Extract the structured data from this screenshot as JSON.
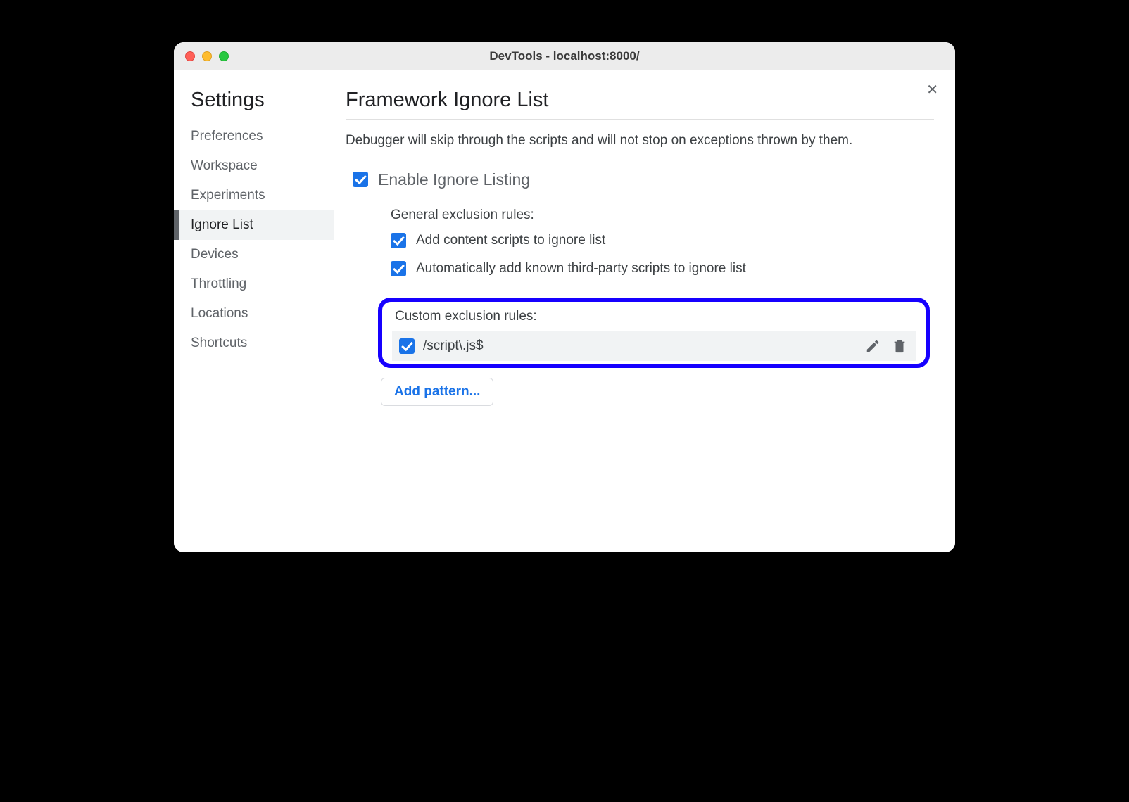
{
  "titlebar": {
    "title": "DevTools - localhost:8000/"
  },
  "sidebar": {
    "title": "Settings",
    "items": [
      {
        "label": "Preferences",
        "selected": false
      },
      {
        "label": "Workspace",
        "selected": false
      },
      {
        "label": "Experiments",
        "selected": false
      },
      {
        "label": "Ignore List",
        "selected": true
      },
      {
        "label": "Devices",
        "selected": false
      },
      {
        "label": "Throttling",
        "selected": false
      },
      {
        "label": "Locations",
        "selected": false
      },
      {
        "label": "Shortcuts",
        "selected": false
      }
    ]
  },
  "main": {
    "title": "Framework Ignore List",
    "description": "Debugger will skip through the scripts and will not stop on exceptions thrown by them.",
    "enable_label": "Enable Ignore Listing",
    "enable_checked": true,
    "general_section_label": "General exclusion rules:",
    "general_rules": [
      {
        "label": "Add content scripts to ignore list",
        "checked": true
      },
      {
        "label": "Automatically add known third-party scripts to ignore list",
        "checked": true
      }
    ],
    "custom_section_label": "Custom exclusion rules:",
    "custom_rules": [
      {
        "pattern": "/script\\.js$",
        "checked": true
      }
    ],
    "add_pattern_label": "Add pattern..."
  },
  "close_label": "✕"
}
